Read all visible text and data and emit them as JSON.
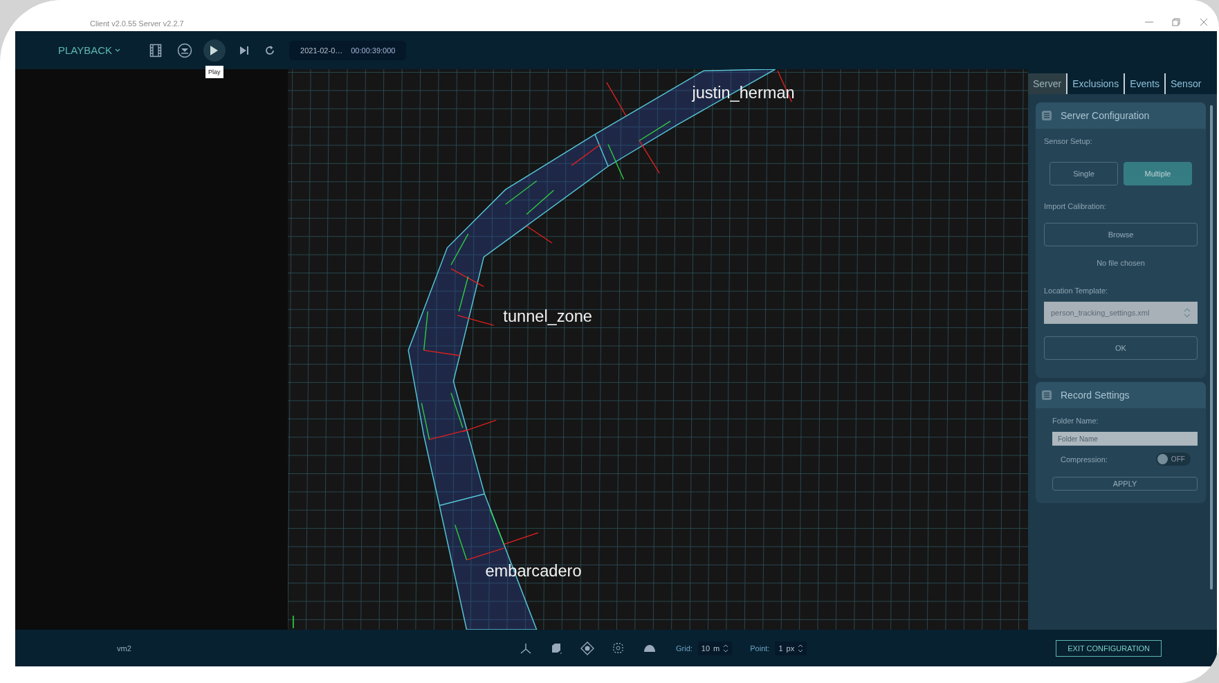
{
  "window": {
    "title": "Client v2.0.55 Server v2.2.7"
  },
  "toolbar": {
    "mode": "PLAYBACK",
    "tooltip": "Play",
    "date": "2021-02-0…",
    "time": "00:00:39:000"
  },
  "viewport": {
    "zones": [
      {
        "label": "justin_herman"
      },
      {
        "label": "tunnel_zone"
      },
      {
        "label": "embarcadero"
      }
    ]
  },
  "sidebar": {
    "tabs": [
      {
        "label": "Server",
        "selected": true
      },
      {
        "label": "Exclusions",
        "selected": false
      },
      {
        "label": "Events",
        "selected": false
      },
      {
        "label": "Sensor",
        "selected": false
      }
    ],
    "server_configuration": {
      "title": "Server Configuration",
      "disabled": true,
      "sensor_setup_label": "Sensor Setup:",
      "options": [
        {
          "label": "Single",
          "selected": false
        },
        {
          "label": "Multiple",
          "selected": true
        }
      ],
      "import_label": "Import Calibration:",
      "browse": "Browse",
      "file_status": "No file chosen",
      "template_label": "Location Template:",
      "template_value": "person_tracking_settings.xml",
      "ok": "OK"
    },
    "record_settings": {
      "title": "Record Settings",
      "disabled": true,
      "folder_label": "Folder Name:",
      "folder_placeholder": "Folder Name",
      "compression_label": "Compression:",
      "compression": {
        "on": false,
        "text": "OFF"
      },
      "apply": "APPLY"
    }
  },
  "status_bar": {
    "view": "vm2",
    "grid": {
      "label": "Grid:",
      "value": "10",
      "unit": "m"
    },
    "point": {
      "label": "Point:",
      "value": "1",
      "unit": "px"
    },
    "exit": "EXIT CONFIGURATION"
  }
}
